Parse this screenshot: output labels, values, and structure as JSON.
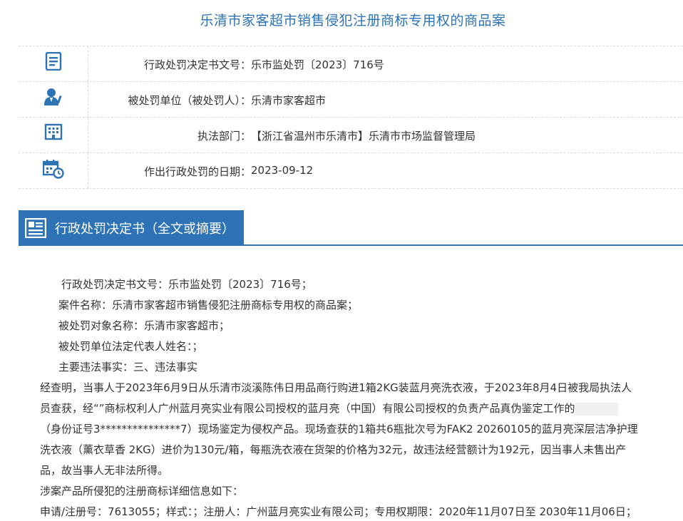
{
  "page": {
    "title": "乐清市家客超市销售侵犯注册商标专用权的商品案"
  },
  "info_rows": [
    {
      "icon": "document-list-icon",
      "label": "行政处罚决定书文号：",
      "value": "乐市监处罚〔2023〕716号"
    },
    {
      "icon": "person-icon",
      "label": "被处罚单位（被处罚人）：",
      "value": "乐清市家客超市"
    },
    {
      "icon": "building-icon",
      "label": "执法部门：",
      "value": "【浙江省温州市乐清市】乐清市市场监督管理局"
    },
    {
      "icon": "calendar-clock-icon",
      "label": "作出行政处罚的日期：",
      "value": "2023-09-12"
    }
  ],
  "section": {
    "icon": "document-icon",
    "title": "行政处罚决定书（全文或摘要）"
  },
  "body": {
    "line1": "行政处罚决定书文号：乐市监处罚〔2023〕716号；",
    "line2": "案件名称：乐清市家客超市销售侵犯注册商标专用权的商品案；",
    "line3": "被处罚对象名称：乐清市家客超市；",
    "line4": "被处罚单位法定代表人姓名：；",
    "line5": "主要违法事实：三、违法事实",
    "para_l1": "经查明，当事人于2023年6月9日从乐清市淡溪陈伟日用品商行购进1箱2KG装蓝月亮洗衣液，于2023年8月4日被我局执法人",
    "para_l2": "员查获，经“”商标权利人广州蓝月亮实业有限公司授权的蓝月亮（中国）有限公司授权的负责产品真伪鉴定工作的",
    "para_l3": "（身份证号3***************7）现场鉴定为侵权产品。现场查获的1箱共6瓶批次号为FAK2 20260105的蓝月亮深层洁净护理",
    "para_l4": "洗衣液（薰衣草香 2KG）进价为130元/箱，每瓶洗衣液在货架的价格为32元，故违法经营额计为192元，因当事人未售出产",
    "para_l5": "品，故当事人无非法所得。",
    "line6": "涉案产品所侵犯的注册商标详细信息如下：",
    "line7": "申请/注册号：7613055；样式：；注册人：广州蓝月亮实业有限公司；专用权期限：2020年11月07日至 2030年11月06日；"
  }
}
